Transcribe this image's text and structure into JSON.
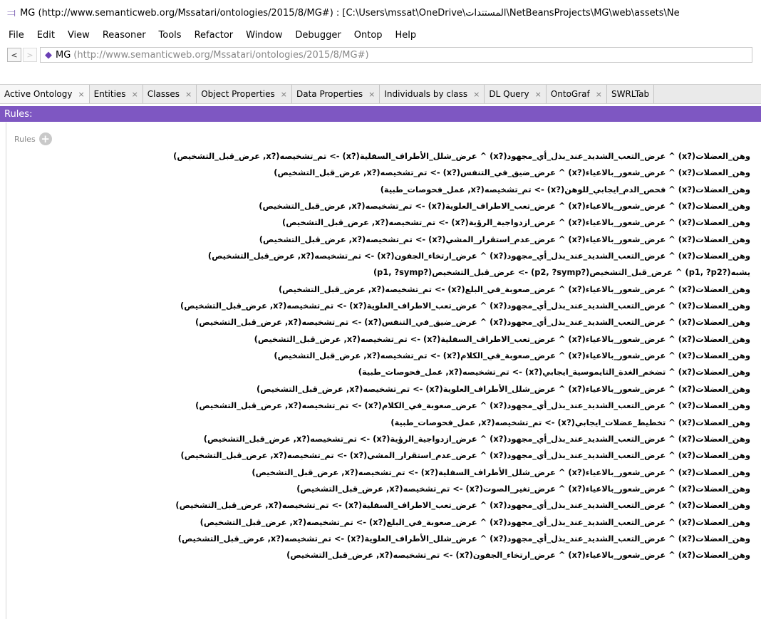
{
  "window": {
    "title": "MG (http://www.semanticweb.org/Mssatari/ontologies/2015/8/MG#)  : [C:\\Users\\mssat\\OneDrive\\المستندات\\NetBeansProjects\\MG\\web\\assets\\Ne"
  },
  "menu": [
    "File",
    "Edit",
    "View",
    "Reasoner",
    "Tools",
    "Refactor",
    "Window",
    "Debugger",
    "Ontop",
    "Help"
  ],
  "address": {
    "back": "<",
    "forward": ">",
    "name": "MG",
    "uri": "(http://www.semanticweb.org/Mssatari/ontologies/2015/8/MG#)"
  },
  "tabs": [
    "Active Ontology",
    "Entities",
    "Classes",
    "Object Properties",
    "Data Properties",
    "Individuals by class",
    "DL Query",
    "OntoGraf",
    "SWRLTab"
  ],
  "tab_close": "×",
  "section_title": "Rules:",
  "rules_label": "Rules",
  "add_symbol": "+",
  "rules": [
    "وهن_العضلات(?x) ^ عرض_التعب_الشديد_عند_بذل_أي_مجهود(?x) ^ عرض_شلل_الأطراف_السفلية(?x) -> تم_تشخيصه(?x, عرض_قبل_التشخيص)",
    "وهن_العضلات(?x) ^ عرض_شعور_بالاعياء(?x) ^ عرض_ضيق_في_التنفس(?x) -> تم_تشخيصه(?x, عرض_قبل_التشخيص)",
    "وهن_العضلات(?x) ^ فحص_الدم_ايجابي_للوهن(?x) -> تم_تشخيصه(?x, عمل_فحوصات_طبية)",
    "وهن_العضلات(?x) ^ عرض_شعور_بالاعياء(?x) ^ عرض_تعب_الاطراف_العلوية(?x) -> تم_تشخيصه(?x, عرض_قبل_التشخيص)",
    "وهن_العضلات(?x) ^ عرض_شعور_بالاعياء(?x) ^ عرض_ازدواجية_الرؤية(?x) -> تم_تشخيصه(?x, عرض_قبل_التشخيص)",
    "وهن_العضلات(?x) ^ عرض_شعور_بالاعياء(?x) ^ عرض_عدم_استقرار_المشي(?x) -> تم_تشخيصه(?x, عرض_قبل_التشخيص)",
    "وهن_العضلات(?x) ^ عرض_التعب_الشديد_عند_بذل_أي_مجهود(?x) ^ عرض_ارتخاء_الجفون(?x) -> تم_تشخيصه(?x, عرض_قبل_التشخيص)",
    "يشبه(?p1, ?p2) ^ عرض_قبل_التشخيص(?p2, ?symp) -> عرض_قبل_التشخيص(?p1, ?symp)",
    "وهن_العضلات(?x) ^ عرض_شعور_بالاعياء(?x) ^ عرض_صعوبة_في_البلع(?x) -> تم_تشخيصه(?x, عرض_قبل_التشخيص)",
    "وهن_العضلات(?x) ^ عرض_التعب_الشديد_عند_بذل_أي_مجهود(?x) ^ عرض_تعب_الاطراف_العلوية(?x) -> تم_تشخيصه(?x, عرض_قبل_التشخيص)",
    "وهن_العضلات(?x) ^ عرض_التعب_الشديد_عند_بذل_أي_مجهود(?x) ^ عرض_ضيق_في_التنفس(?x) -> تم_تشخيصه(?x, عرض_قبل_التشخيص)",
    "وهن_العضلات(?x) ^ عرض_شعور_بالاعياء(?x) ^ عرض_تعب_الاطراف_السفلية(?x) -> تم_تشخيصه(?x, عرض_قبل_التشخيص)",
    "وهن_العضلات(?x) ^ عرض_شعور_بالاعياء(?x) ^ عرض_صعوبة_في_الكلام(?x) -> تم_تشخيصه(?x, عرض_قبل_التشخيص)",
    "وهن_العضلات(?x) ^ تضخم_الغدة_التايموسية_ايجابي(?x) -> تم_تشخيصه(?x, عمل_فحوصات_طبية)",
    "وهن_العضلات(?x) ^ عرض_شعور_بالاعياء(?x) ^ عرض_شلل_الأطراف_العلوية(?x) -> تم_تشخيصه(?x, عرض_قبل_التشخيص)",
    "وهن_العضلات(?x) ^ عرض_التعب_الشديد_عند_بذل_أي_مجهود(?x) ^ عرض_صعوبة_في_الكلام(?x) -> تم_تشخيصه(?x, عرض_قبل_التشخيص)",
    "وهن_العضلات(?x) ^ تخطيط_عضلات_ايجابي(?x) -> تم_تشخيصه(?x, عمل_فحوصات_طبية)",
    "وهن_العضلات(?x) ^ عرض_التعب_الشديد_عند_بذل_أي_مجهود(?x) ^ عرض_ازدواجية_الرؤية(?x) -> تم_تشخيصه(?x, عرض_قبل_التشخيص)",
    "وهن_العضلات(?x) ^ عرض_التعب_الشديد_عند_بذل_أي_مجهود(?x) ^ عرض_عدم_استقرار_المشي(?x) -> تم_تشخيصه(?x, عرض_قبل_التشخيص)",
    "وهن_العضلات(?x) ^ عرض_شعور_بالاعياء(?x) ^ عرض_شلل_الأطراف_السفلية(?x) -> تم_تشخيصه(?x, عرض_قبل_التشخيص)",
    "وهن_العضلات(?x) ^ عرض_شعور_بالاعياء(?x) ^ عرض_تغير_الصوت(?x) -> تم_تشخيصه(?x, عرض_قبل_التشخيص)",
    "وهن_العضلات(?x) ^ عرض_التعب_الشديد_عند_بذل_أي_مجهود(?x) ^ عرض_تعب_الاطراف_السفلية(?x) -> تم_تشخيصه(?x, عرض_قبل_التشخيص)",
    "وهن_العضلات(?x) ^ عرض_التعب_الشديد_عند_بذل_أي_مجهود(?x) ^ عرض_صعوبة_في_البلع(?x) -> تم_تشخيصه(?x, عرض_قبل_التشخيص)",
    "وهن_العضلات(?x) ^ عرض_التعب_الشديد_عند_بذل_أي_مجهود(?x) ^ عرض_شلل_الأطراف_العلوية(?x) -> تم_تشخيصه(?x, عرض_قبل_التشخيص)",
    "وهن_العضلات(?x) ^ عرض_شعور_بالاعياء(?x) ^ عرض_ارتخاء_الجفون(?x) -> تم_تشخيصه(?x, عرض_قبل_التشخيص)"
  ],
  "icons": {
    "app": "protege-app-icon",
    "ontology": "ontology-diamond-icon",
    "add": "add-rule-icon"
  },
  "colors": {
    "section_header": "#7e57c2",
    "ontology_icon": "#6a3fb5"
  }
}
